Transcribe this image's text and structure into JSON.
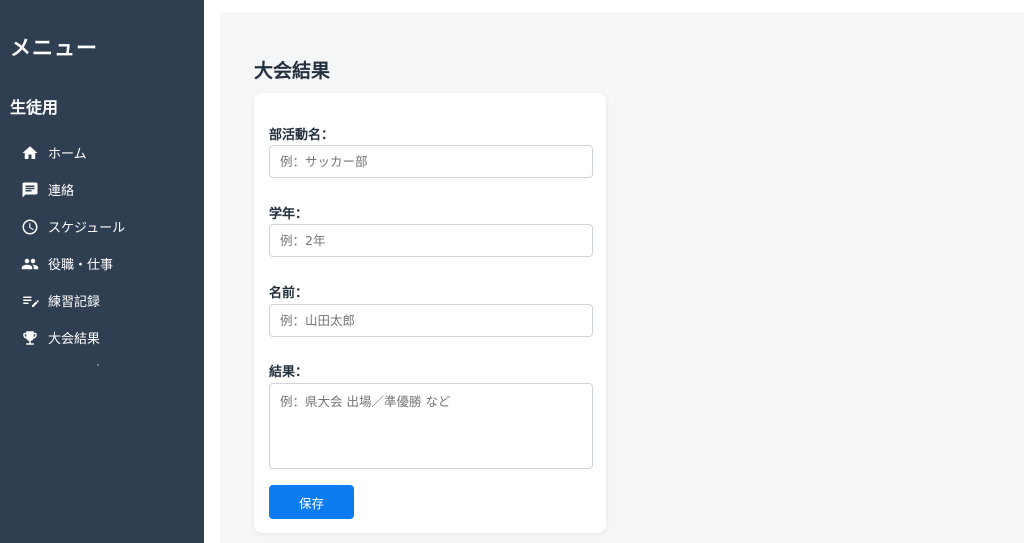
{
  "sidebar": {
    "title": "メニュー",
    "section": "生徒用",
    "items": [
      {
        "label": "ホーム",
        "icon": "home-icon"
      },
      {
        "label": "連絡",
        "icon": "message-icon"
      },
      {
        "label": "スケジュール",
        "icon": "clock-icon"
      },
      {
        "label": "役職・仕事",
        "icon": "people-icon"
      },
      {
        "label": "練習記録",
        "icon": "edit-notes-icon"
      },
      {
        "label": "大会結果",
        "icon": "trophy-icon"
      }
    ]
  },
  "main": {
    "title": "大会結果",
    "form": {
      "club": {
        "label": "部活動名：",
        "placeholder": "例：サッカー部",
        "value": ""
      },
      "grade": {
        "label": "学年：",
        "placeholder": "例：2年",
        "value": ""
      },
      "name": {
        "label": "名前：",
        "placeholder": "例：山田太郎",
        "value": ""
      },
      "result": {
        "label": "結果：",
        "placeholder": "例：県大会 出場／準優勝 など",
        "value": ""
      },
      "save_label": "保存"
    }
  },
  "colors": {
    "sidebar_bg": "#2f3e51",
    "main_bg": "#f5f6f8",
    "accent": "#0a7cf0"
  }
}
